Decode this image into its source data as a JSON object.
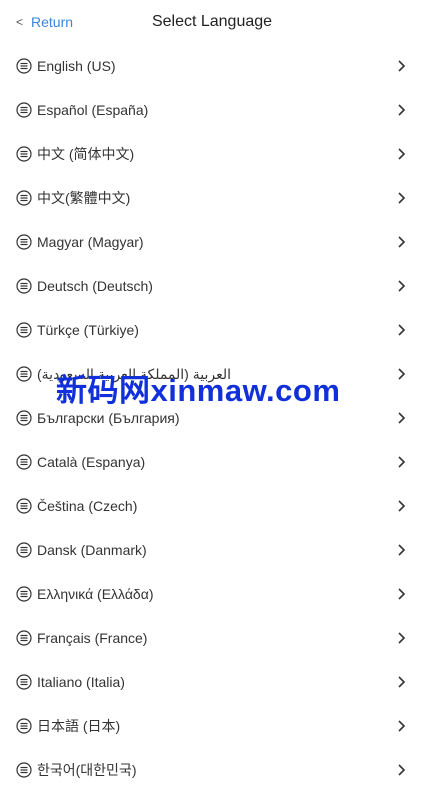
{
  "header": {
    "back_chevron": "<",
    "back_label": "Return",
    "title": "Select Language"
  },
  "languages": [
    {
      "label": "English (US)"
    },
    {
      "label": "Español (España)"
    },
    {
      "label": "中文 (简体中文)"
    },
    {
      "label": "中文(繁體中文)"
    },
    {
      "label": "Magyar (Magyar)"
    },
    {
      "label": "Deutsch (Deutsch)"
    },
    {
      "label": "Türkçe (Türkiye)"
    },
    {
      "label": "العربية (المملكة العربية السعودية)"
    },
    {
      "label": "Български (България)"
    },
    {
      "label": "Català (Espanya)"
    },
    {
      "label": "Čeština (Czech)"
    },
    {
      "label": "Dansk (Danmark)"
    },
    {
      "label": "Ελληνικά (Ελλάδα)"
    },
    {
      "label": "Français (France)"
    },
    {
      "label": "Italiano (Italia)"
    },
    {
      "label": "日本語 (日本)"
    },
    {
      "label": "한국어(대한민국)"
    }
  ],
  "watermark": "新码网xinmaw.com",
  "colors": {
    "accent": "#3a86d8",
    "text": "#333333",
    "watermark": "#1230d9"
  }
}
